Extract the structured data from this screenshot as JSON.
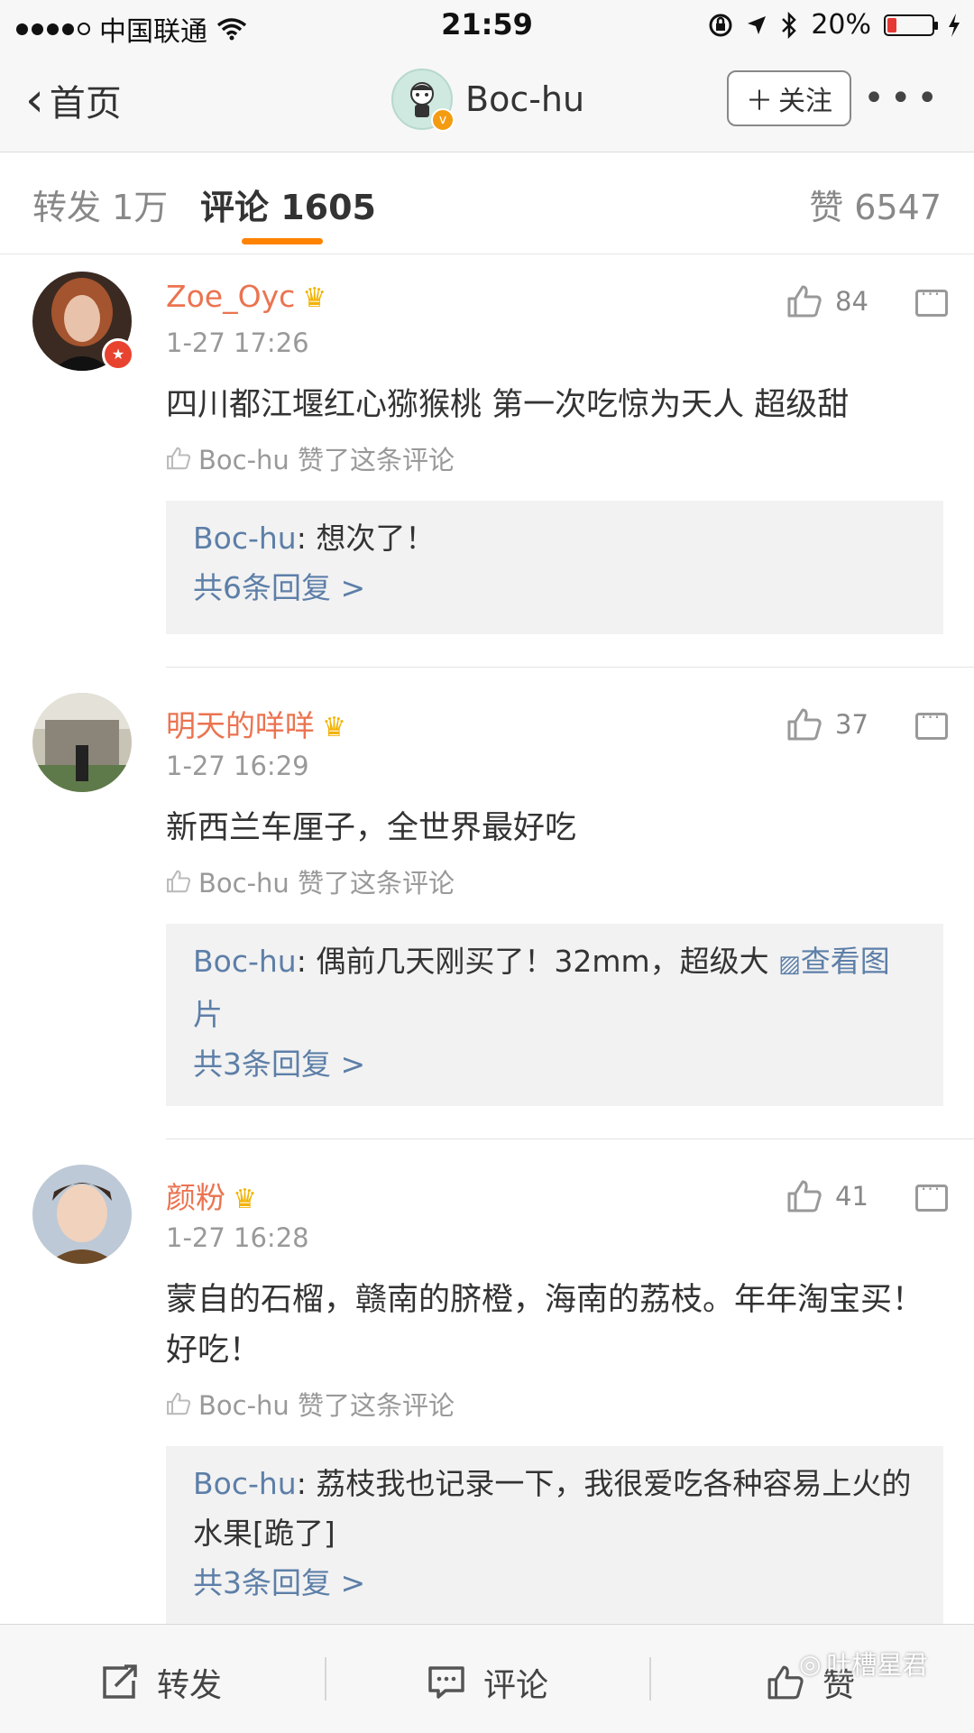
{
  "status_bar": {
    "carrier": "中国联通",
    "time": "21:59",
    "battery_percent": "20%",
    "icons": [
      "signal-icon",
      "wifi-icon",
      "lock-rotation-icon",
      "location-icon",
      "bluetooth-icon",
      "battery-icon",
      "charging-icon"
    ]
  },
  "nav": {
    "back_label": "首页",
    "author_name": "Boc-hu",
    "follow_label": "关注",
    "follow_icon": "plus-icon",
    "more_icon": "more-icon"
  },
  "tabs": {
    "repost": "转发 1万",
    "comments": "评论 1605",
    "likes": "赞 6547",
    "accent_color": "#ff8200"
  },
  "comments": [
    {
      "name": "Zoe_Oyc",
      "time": "1-27 17:26",
      "likes": "84",
      "text": "四川都江堰红心猕猴桃 第一次吃惊为天人 超级甜",
      "liked_by": "Boc-hu 赞了这条评论",
      "reply_user": "Boc-hu",
      "reply_text": ": 想次了！",
      "reply_count": "共6条回复 >"
    },
    {
      "name": "明天的咩咩",
      "time": "1-27 16:29",
      "likes": "37",
      "text": "新西兰车厘子，全世界最好吃",
      "liked_by": "Boc-hu 赞了这条评论",
      "reply_user": "Boc-hu",
      "reply_text": ": 偶前几天刚买了！32mm，超级大",
      "reply_link": "查看图片",
      "reply_count": "共3条回复 >"
    },
    {
      "name": "颜粉",
      "time": "1-27 16:28",
      "likes": "41",
      "text": "蒙自的石榴，赣南的脐橙，海南的荔枝。年年淘宝买！好吃！",
      "liked_by": "Boc-hu 赞了这条评论",
      "reply_user": "Boc-hu",
      "reply_text": ": 荔枝我也记录一下，我很爱吃各种容易上火的水果[跪了]",
      "reply_count": "共3条回复 >"
    }
  ],
  "bottom_bar": {
    "repost": "转发",
    "comment": "评论",
    "like": "赞"
  },
  "watermark": "吐槽星君",
  "colors": {
    "username": "#eb7350",
    "link": "#5d7fa8",
    "crown": "#f2b200"
  }
}
